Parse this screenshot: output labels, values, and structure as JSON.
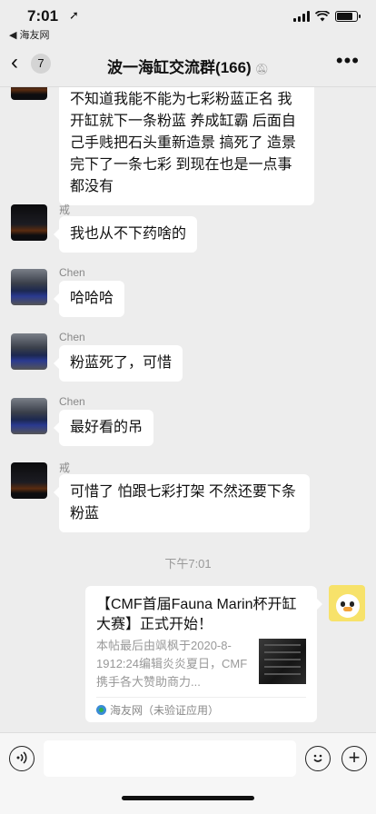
{
  "status": {
    "time": "7:01",
    "location_icon": "location-arrow-icon",
    "back_app": "◀ 海友网"
  },
  "nav": {
    "back_icon": "chevron-left-icon",
    "unread": "7",
    "title": "波一海缸交流群(166)",
    "mute_icon": "bell-slash-icon",
    "more_icon": "more-dots-icon"
  },
  "messages": [
    {
      "sender": "",
      "text": "不知道我能不能为七彩粉蓝正名 我开缸就下一条粉蓝  养成缸霸 后面自己手贱把石头重新造景 搞死了  造景完下了一条七彩 到现在也是一点事都没有"
    },
    {
      "sender": "戒",
      "text": "我也从不下药啥的"
    },
    {
      "sender": "Chen",
      "text": "哈哈哈"
    },
    {
      "sender": "Chen",
      "text": "粉蓝死了，可惜"
    },
    {
      "sender": "Chen",
      "text": "最好看的吊"
    },
    {
      "sender": "戒",
      "text": "可惜了 怕跟七彩打架 不然还要下条粉蓝"
    }
  ],
  "timestamp": "下午7:01",
  "card": {
    "title": "【CMF首届Fauna Marin杯开缸大赛】正式开始！",
    "description": "本帖最后由飒枫于2020-8-1912:24编辑炎炎夏日，CMF携手各大赞助商力...",
    "source": "海友网（未验证应用）"
  },
  "inputbar": {
    "voice_icon": "voice-icon",
    "emoji_icon": "emoji-icon",
    "plus_icon": "plus-icon"
  }
}
